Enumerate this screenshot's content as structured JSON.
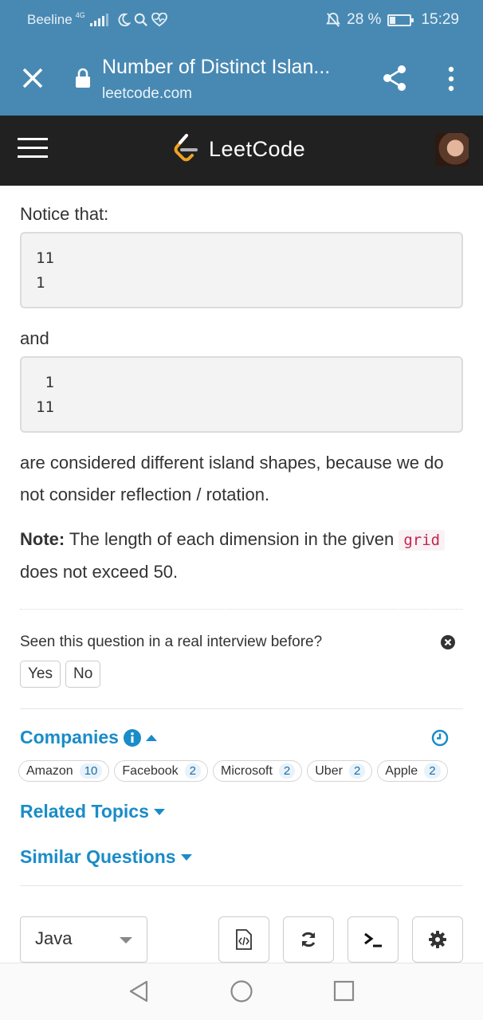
{
  "status_bar": {
    "carrier": "Beeline",
    "network": "4G",
    "battery_percent": "28 %",
    "time": "15:29"
  },
  "browser": {
    "page_title": "Number of Distinct Islan...",
    "url": "leetcode.com",
    "close_icon": "close-icon",
    "lock_icon": "lock-icon",
    "share_icon": "share-icon",
    "menu_icon": "more-vert-icon"
  },
  "site_nav": {
    "brand": "LeetCode",
    "menu_icon": "hamburger-icon"
  },
  "problem": {
    "notice_text": "Notice that:",
    "shape_one": "11\n1",
    "and_text": "and",
    "shape_two": " 1\n11",
    "explanation": "are considered different island shapes, because we do not consider reflection / rotation.",
    "note_label": "Note:",
    "note_text_1": " The length of each dimension in the given ",
    "note_code": "grid",
    "note_text_2": " does not exceed 50."
  },
  "interview": {
    "question": "Seen this question in a real interview before?",
    "yes_label": "Yes",
    "no_label": "No"
  },
  "companies": {
    "heading": "Companies",
    "tags": [
      {
        "name": "Amazon",
        "count": "10"
      },
      {
        "name": "Facebook",
        "count": "2"
      },
      {
        "name": "Microsoft",
        "count": "2"
      },
      {
        "name": "Uber",
        "count": "2"
      },
      {
        "name": "Apple",
        "count": "2"
      }
    ]
  },
  "related_topics": {
    "heading": "Related Topics"
  },
  "similar_questions": {
    "heading": "Similar Questions"
  },
  "editor": {
    "language": "Java"
  },
  "colors": {
    "browser_bar": "#4889b3",
    "site_nav": "#212121",
    "link": "#1a8cc8",
    "brand_accent": "#f0a122"
  }
}
